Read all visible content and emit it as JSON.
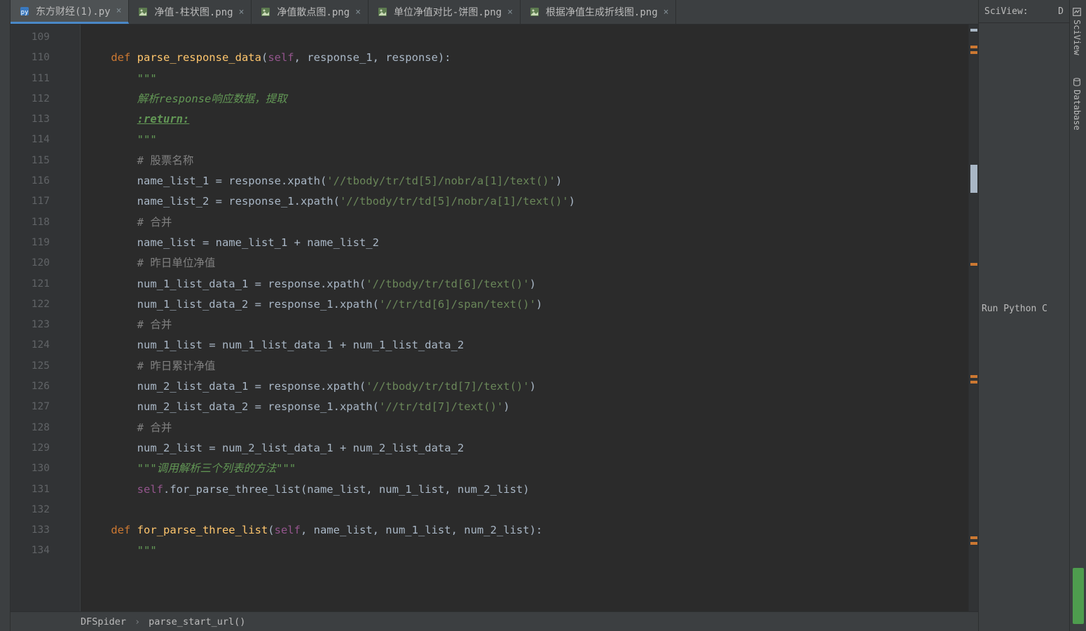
{
  "tabs": [
    {
      "label": "东方财经(1).py",
      "type": "py",
      "active": true
    },
    {
      "label": "净值-柱状图.png",
      "type": "img",
      "active": false
    },
    {
      "label": "净值散点图.png",
      "type": "img",
      "active": false
    },
    {
      "label": "单位净值对比-饼图.png",
      "type": "img",
      "active": false
    },
    {
      "label": "根据净值生成折线图.png",
      "type": "img",
      "active": false
    }
  ],
  "line_numbers": [
    "109",
    "110",
    "111",
    "112",
    "113",
    "114",
    "115",
    "116",
    "117",
    "118",
    "119",
    "120",
    "121",
    "122",
    "123",
    "124",
    "125",
    "126",
    "127",
    "128",
    "129",
    "130",
    "131",
    "132",
    "133",
    "134"
  ],
  "code": {
    "l109": "",
    "l110_def": "def ",
    "l110_fn": "parse_response_data",
    "l110_open": "(",
    "l110_self": "self",
    "l110_rest": ", response_1, response):",
    "l111": "        \"\"\"",
    "l112": "        解析response响应数据，提取",
    "l113_pre": "        ",
    "l113_ret": ":return:",
    "l114": "        \"\"\"",
    "l115": "        # 股票名称",
    "l116_a": "        name_list_1 = response.xpath(",
    "l116_s": "'//tbody/tr/td[5]/nobr/a[1]/text()'",
    "l116_b": ")",
    "l117_a": "        name_list_2 = response_1.xpath(",
    "l117_s": "'//tbody/tr/td[5]/nobr/a[1]/text()'",
    "l117_b": ")",
    "l118": "        # 合并",
    "l119": "        name_list = name_list_1 + name_list_2",
    "l120": "        # 昨日单位净值",
    "l121_a": "        num_1_list_data_1 = response.xpath(",
    "l121_s": "'//tbody/tr/td[6]/text()'",
    "l121_b": ")",
    "l122_a": "        num_1_list_data_2 = response_1.xpath(",
    "l122_s": "'//tr/td[6]/span/text()'",
    "l122_b": ")",
    "l123": "        # 合并",
    "l124": "        num_1_list = num_1_list_data_1 + num_1_list_data_2",
    "l125": "        # 昨日累计净值",
    "l126_a": "        num_2_list_data_1 = response.xpath(",
    "l126_s": "'//tbody/tr/td[7]/text()'",
    "l126_b": ")",
    "l127_a": "        num_2_list_data_2 = response_1.xpath(",
    "l127_s": "'//tr/td[7]/text()'",
    "l127_b": ")",
    "l128": "        # 合并",
    "l129": "        num_2_list = num_2_list_data_1 + num_2_list_data_2",
    "l130": "        \"\"\"调用解析三个列表的方法\"\"\"",
    "l131_self": "        self",
    "l131_rest": ".for_parse_three_list(name_list, num_1_list, num_2_list)",
    "l132": "",
    "l133_def": "    def ",
    "l133_fn": "for_parse_three_list",
    "l133_open": "(",
    "l133_self": "self",
    "l133_rest": ", name_list, num_1_list, num_2_list):",
    "l134": "        \"\"\""
  },
  "breadcrumb": {
    "c1": "DFSpider",
    "c2": "parse_start_url()"
  },
  "right_panel": {
    "title": "SciView:",
    "d": "D",
    "run_label": "Run Python C"
  },
  "tool_window": {
    "sciview": "SciView",
    "database": "Database"
  }
}
